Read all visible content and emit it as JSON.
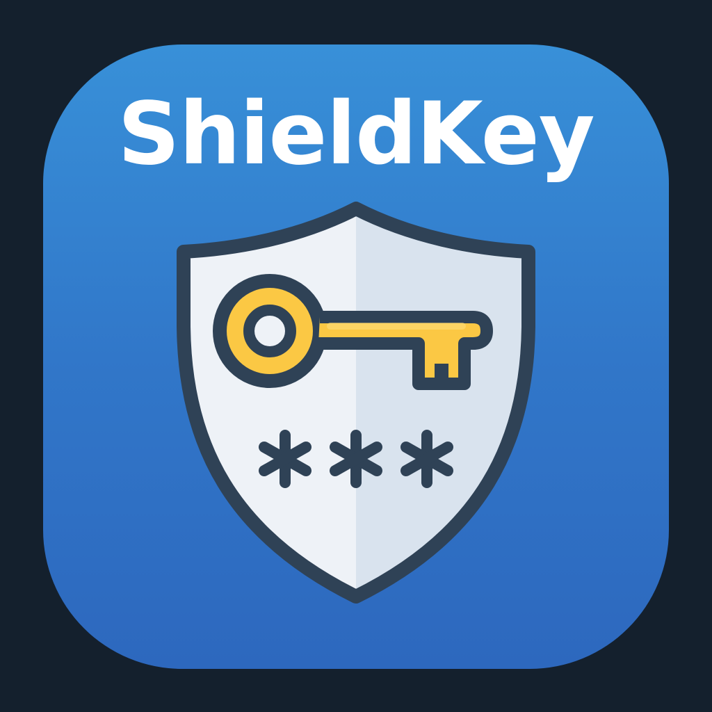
{
  "app": {
    "name": "ShieldKey"
  },
  "icons": {
    "shield": "shield-icon",
    "key": "key-icon",
    "password": "asterisk-icon"
  },
  "colors": {
    "background": "#14202d",
    "tile_top": "#3890d8",
    "tile_bottom": "#2d68be",
    "shield_left": "#eef2f7",
    "shield_right": "#d9e3ee",
    "outline": "#2f4256",
    "key_gold": "#fbc844",
    "title_text": "#ffffff"
  }
}
